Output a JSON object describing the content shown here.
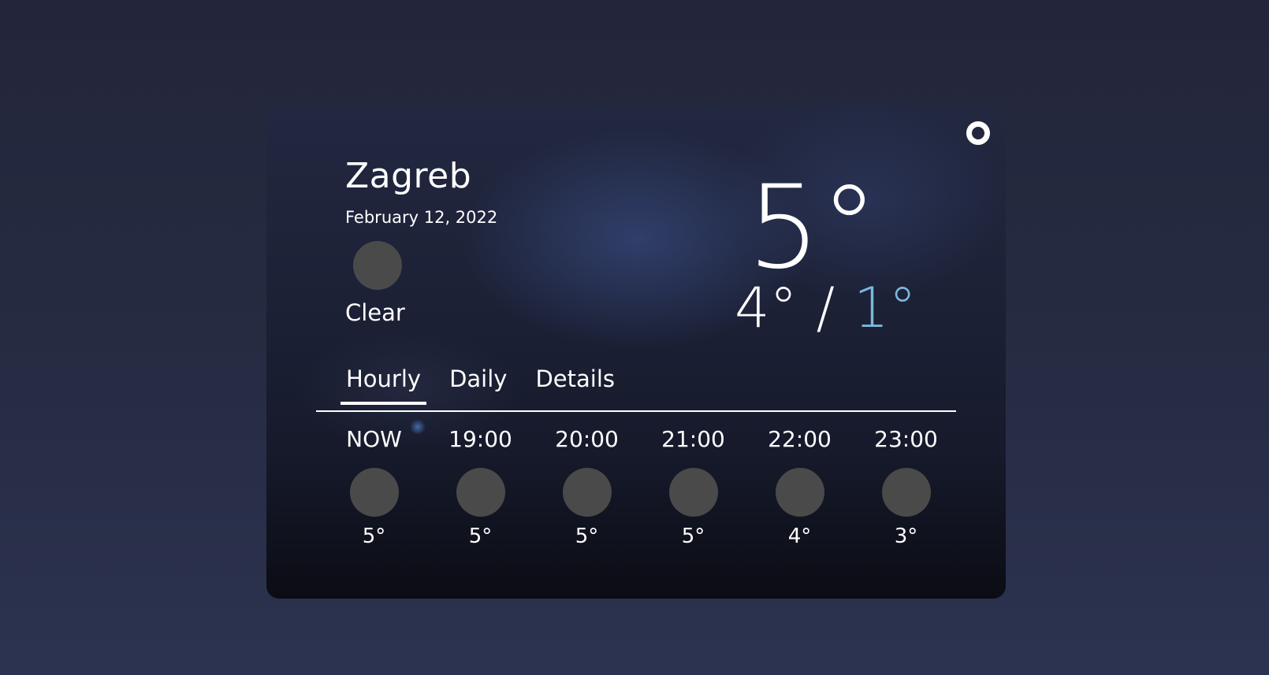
{
  "current": {
    "city": "Zagreb",
    "date": "February 12, 2022",
    "condition": "Clear",
    "condition_icon": "weather-icon",
    "temp": "5°",
    "high": "4°",
    "separator": "/",
    "low": "1°"
  },
  "tabs": [
    {
      "label": "Hourly",
      "active": true
    },
    {
      "label": "Daily",
      "active": false
    },
    {
      "label": "Details",
      "active": false
    }
  ],
  "hourly": [
    {
      "time": "NOW",
      "temp": "5°"
    },
    {
      "time": "19:00",
      "temp": "5°"
    },
    {
      "time": "20:00",
      "temp": "5°"
    },
    {
      "time": "21:00",
      "temp": "5°"
    },
    {
      "time": "22:00",
      "temp": "4°"
    },
    {
      "time": "23:00",
      "temp": "3°"
    }
  ],
  "colors": {
    "page_bg": "#262b42",
    "low_temp": "#7ab8dc",
    "icon_placeholder": "#4a4a4a",
    "text": "#ffffff"
  }
}
